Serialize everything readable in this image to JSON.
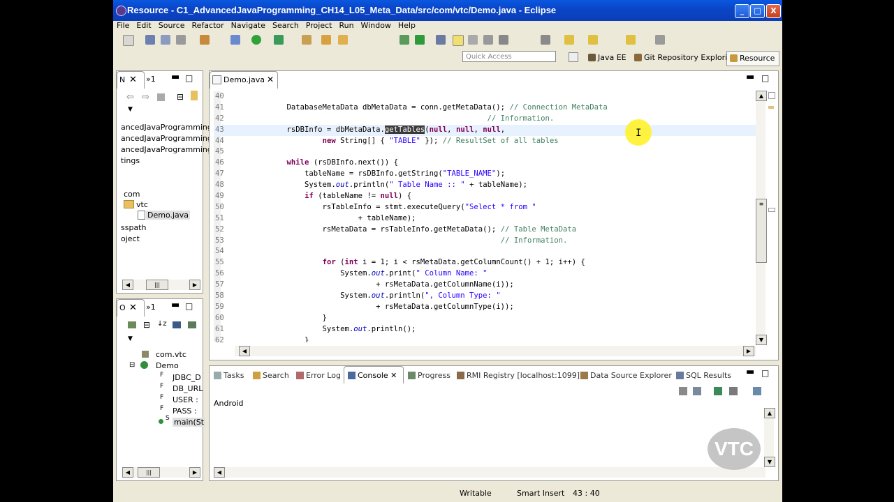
{
  "window": {
    "title": "Resource - C1_AdvancedJavaProgramming_CH14_L05_Meta_Data/src/com/vtc/Demo.java - Eclipse",
    "min": "_",
    "max": "□",
    "close": "X"
  },
  "menu": [
    "File",
    "Edit",
    "Source",
    "Refactor",
    "Navigate",
    "Search",
    "Project",
    "Run",
    "Window",
    "Help"
  ],
  "quick_access": {
    "placeholder": "Quick Access"
  },
  "perspectives": [
    "Java EE",
    "Git Repository Exploring",
    "Resource"
  ],
  "navigator": {
    "tabs": [
      "N",
      "»1"
    ],
    "items": [
      "ancedJavaProgramming",
      "ancedJavaProgramming",
      "ancedJavaProgramming",
      "tings",
      "com",
      "vtc",
      "Demo.java",
      "sspath",
      "oject"
    ]
  },
  "outline": {
    "tabs": [
      "O",
      "»1"
    ],
    "items": [
      "com.vtc",
      "Demo",
      "JDBC_D",
      "DB_URL",
      "USER :",
      "PASS :",
      "main(St"
    ],
    "badges": [
      "F",
      "F",
      "F",
      "F",
      "S"
    ]
  },
  "editor": {
    "tab": "Demo.java",
    "lines": [
      {
        "n": "40",
        "html": ""
      },
      {
        "n": "41",
        "html": "            DatabaseMetaData dbMetaData = conn.getMetaData(); <span class='cm'>// Connection MetaData</span>"
      },
      {
        "n": "42",
        "html": "                                                         <span class='cm'>// Information.</span>"
      },
      {
        "n": "43",
        "html": "            rsDBInfo = dbMetaData.<span class='sel'>getTables</span>(<span class='kw'>null</span>, <span class='kw'>null</span>, <span class='kw'>null</span>,"
      },
      {
        "n": "44",
        "html": "                    <span class='kw'>new</span> String[] { <span class='st'>\"TABLE\"</span> }); <span class='cm'>// ResultSet of all tables</span>"
      },
      {
        "n": "45",
        "html": ""
      },
      {
        "n": "46",
        "html": "            <span class='kw'>while</span> (rsDBInfo.next()) {"
      },
      {
        "n": "47",
        "html": "                tableName = rsDBInfo.getString(<span class='st'>\"TABLE_NAME\"</span>);"
      },
      {
        "n": "48",
        "html": "                System.<span class='it'>out</span>.println(<span class='st'>\" Table Name :: \"</span> + tableName);"
      },
      {
        "n": "49",
        "html": "                <span class='kw'>if</span> (tableName != <span class='kw'>null</span>) {"
      },
      {
        "n": "50",
        "html": "                    rsTableInfo = stmt.executeQuery(<span class='st'>\"Select * from \"</span>"
      },
      {
        "n": "51",
        "html": "                            + tableName);"
      },
      {
        "n": "52",
        "html": "                    rsMetaData = rsTableInfo.getMetaData(); <span class='cm'>// Table MetaData</span>"
      },
      {
        "n": "53",
        "html": "                                                            <span class='cm'>// Information.</span>"
      },
      {
        "n": "54",
        "html": ""
      },
      {
        "n": "55",
        "html": "                    <span class='kw'>for</span> (<span class='kw'>int</span> i = 1; i &lt; rsMetaData.getColumnCount() + 1; i++) {"
      },
      {
        "n": "56",
        "html": "                        System.<span class='it'>out</span>.print(<span class='st'>\" Column Name: \"</span>"
      },
      {
        "n": "57",
        "html": "                                + rsMetaData.getColumnName(i));"
      },
      {
        "n": "58",
        "html": "                        System.<span class='it'>out</span>.println(<span class='st'>\", Column Type: \"</span>"
      },
      {
        "n": "59",
        "html": "                                + rsMetaData.getColumnType(i));"
      },
      {
        "n": "60",
        "html": "                    }"
      },
      {
        "n": "61",
        "html": "                    System.<span class='it'>out</span>.println();"
      },
      {
        "n": "62",
        "html": "                }"
      }
    ]
  },
  "bottom_tabs": [
    "Tasks",
    "Search",
    "Error Log",
    "Console",
    "Progress",
    "RMI Registry [localhost:1099]",
    "Data Source Explorer",
    "SQL Results"
  ],
  "console": {
    "label": "Android"
  },
  "status": {
    "writable": "Writable",
    "insert": "Smart Insert",
    "position": "43 : 40"
  },
  "watermark": "VTC",
  "colors": {
    "title_bar": "#0a46c8",
    "keyword": "#7f0055",
    "comment": "#3f7f5f",
    "string": "#2a00ff",
    "chrome": "#ece9d8"
  }
}
